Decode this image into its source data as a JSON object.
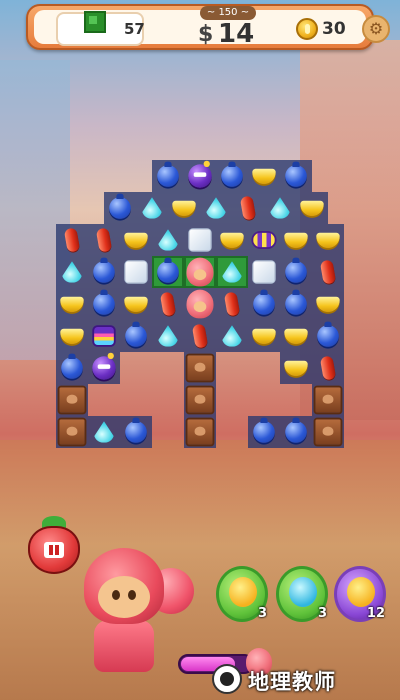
{
  "hud": {
    "goal_count": "57",
    "moves_best": "~ 150 ~",
    "moves_icon": "$",
    "moves_left": "14",
    "coins": "30",
    "settings_icon": "gear-icon"
  },
  "board": {
    "legend": {
      "blue": "blue jelly",
      "cyan": "cyan jelly",
      "yellow": "yellow jelly",
      "red": "red jelly",
      "bomb": "purple bomb",
      "striped": "striped candy",
      "rainbow": "rainbow candy",
      "ice": "ice block",
      "choc": "chocolate block",
      "cookie": "cookie piece"
    },
    "rows": [
      [
        null,
        null,
        "blue",
        "bomb",
        "blue",
        "yellow",
        "blue",
        null
      ],
      [
        null,
        "blue",
        "cyan",
        "yellow",
        "cyan",
        "red",
        "cyan",
        "yellow"
      ],
      [
        "red",
        "red",
        "yellow",
        "cyan",
        "ice",
        "yellow",
        "striped",
        "yellow",
        "yellow"
      ],
      [
        "cyan",
        "blue",
        "ice",
        "blue*",
        "cookie*",
        "cyan*",
        "ice",
        "blue",
        "red"
      ],
      [
        "yellow",
        "blue",
        "yellow",
        "red",
        "cookie",
        "red",
        "blue",
        "blue",
        "yellow"
      ],
      [
        "yellow",
        "rainbow",
        "blue",
        "cyan",
        "red",
        "cyan",
        "yellow",
        "yellow",
        "blue"
      ],
      [
        "blue",
        "bomb",
        null,
        null,
        "choc",
        null,
        null,
        "yellow",
        "red"
      ],
      [
        "choc",
        null,
        null,
        null,
        "choc",
        null,
        null,
        null,
        "choc"
      ],
      [
        "choc",
        "cyan",
        "blue",
        null,
        "choc",
        null,
        "blue",
        "blue",
        "choc"
      ]
    ]
  },
  "badge": {
    "label": "pause",
    "icon": "strawberry-pause-icon"
  },
  "boosters": [
    {
      "name": "yellow bear booster",
      "count": "3",
      "icon": "bear-icon"
    },
    {
      "name": "blue glove booster",
      "count": "3",
      "icon": "glove-icon"
    },
    {
      "name": "star bomb booster",
      "count": "12",
      "icon": "star-icon"
    }
  ],
  "power": {
    "fill": 0.75
  },
  "watermark": {
    "text": "地理教师"
  }
}
